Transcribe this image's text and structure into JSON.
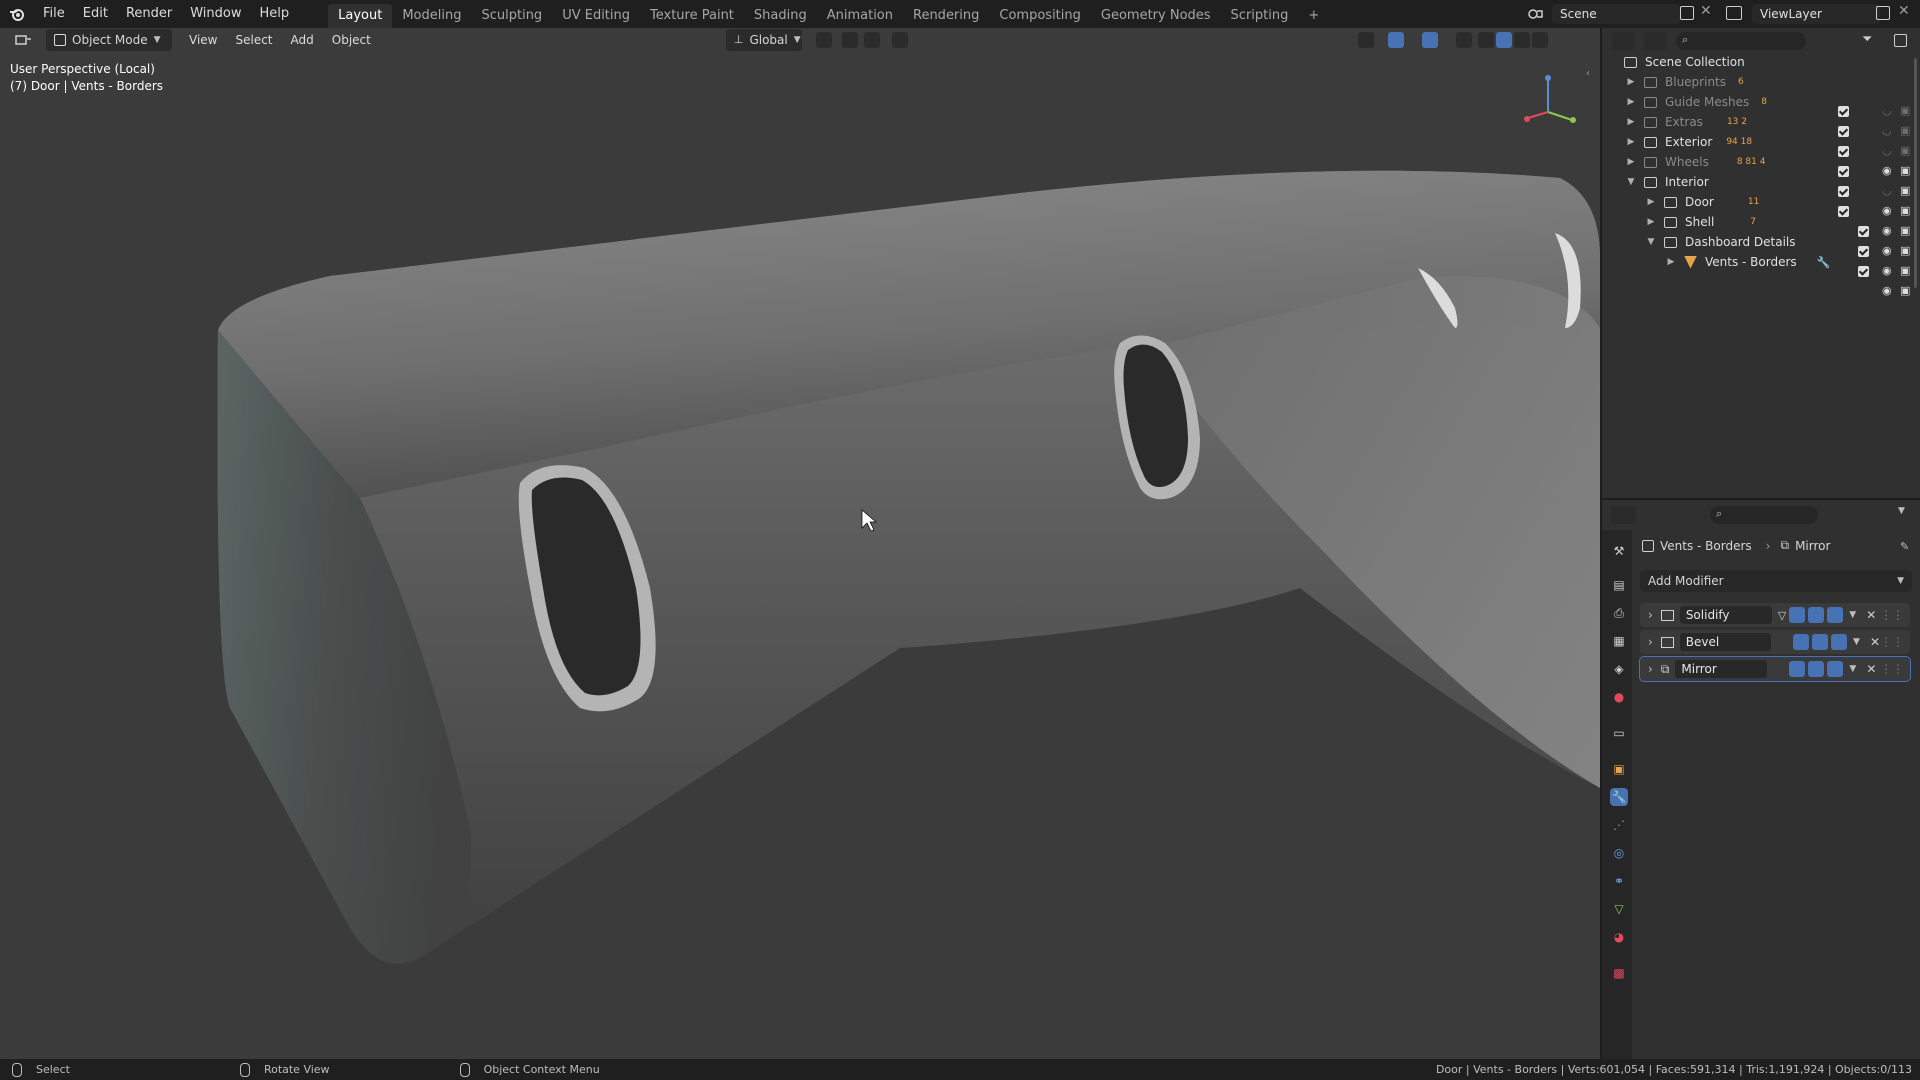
{
  "topbar": {
    "menus": [
      "File",
      "Edit",
      "Render",
      "Window",
      "Help"
    ],
    "workspaces": [
      "Layout",
      "Modeling",
      "Sculpting",
      "UV Editing",
      "Texture Paint",
      "Shading",
      "Animation",
      "Rendering",
      "Compositing",
      "Geometry Nodes",
      "Scripting"
    ],
    "active_workspace": "Layout",
    "add_tab": "+",
    "scene": "Scene",
    "view_layer": "ViewLayer"
  },
  "viewport_header": {
    "mode": "Object Mode",
    "menus": [
      "View",
      "Select",
      "Add",
      "Object"
    ],
    "orientation": "Global"
  },
  "viewport": {
    "perspective": "User Perspective (Local)",
    "object_info": "(7) Door | Vents - Borders"
  },
  "outliner": {
    "root": "Scene Collection",
    "rows": [
      {
        "label": "Blueprints",
        "count": "6",
        "dim": true
      },
      {
        "label": "Guide Meshes",
        "count": "8",
        "dim": true
      },
      {
        "label": "Extras",
        "count": "13 2",
        "dim": true
      },
      {
        "label": "Exterior",
        "count": "94 18",
        "dim": false
      },
      {
        "label": "Wheels",
        "count": "8 81 4",
        "dim": true
      },
      {
        "label": "Interior",
        "count": "",
        "dim": false
      },
      {
        "label": "Door",
        "count": "11",
        "dim": false
      },
      {
        "label": "Shell",
        "count": "7",
        "dim": false
      },
      {
        "label": "Dashboard Details",
        "count": "",
        "dim": false
      },
      {
        "label": "Vents - Borders",
        "count": "",
        "dim": false
      }
    ]
  },
  "properties": {
    "breadcrumb_object": "Vents - Borders",
    "breadcrumb_modifier": "Mirror",
    "add_modifier": "Add Modifier",
    "modifiers": [
      "Solidify",
      "Bevel",
      "Mirror"
    ]
  },
  "status_bar": {
    "select": "Select",
    "rotate": "Rotate View",
    "context": "Object Context Menu",
    "stats": "Door | Vents - Borders | Verts:601,054 | Faces:591,314 | Tris:1,191,924 | Objects:0/113"
  },
  "colors": {
    "accent": "#4772b3",
    "collection_count": "#e6a34b"
  }
}
